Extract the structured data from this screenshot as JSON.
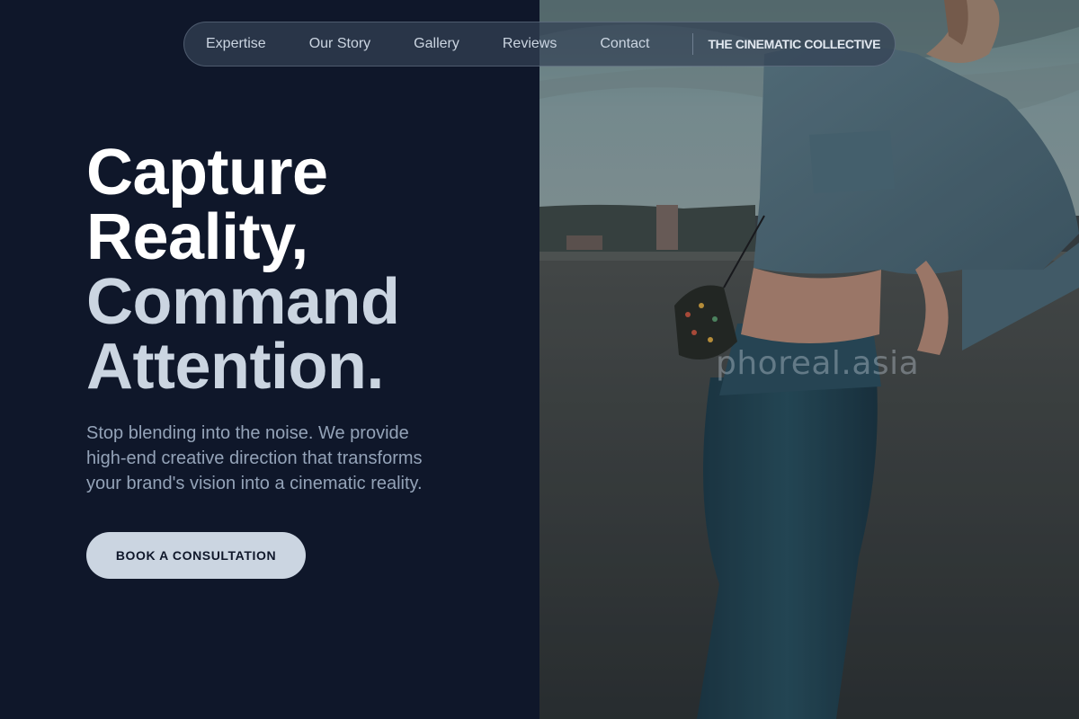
{
  "nav": {
    "links": [
      "Expertise",
      "Our Story",
      "Gallery",
      "Reviews",
      "Contact"
    ],
    "brand": "THE CINEMATIC COLLECTIVE"
  },
  "hero": {
    "title_lines": [
      "Capture",
      "Reality,",
      "Command",
      "Attention."
    ],
    "subtitle": "Stop blending into the noise. We provide high-end creative direction that transforms your brand's vision into a cinematic reality.",
    "cta_label": "BOOK A CONSULTATION"
  },
  "photo": {
    "watermark": "phoreal.asia"
  },
  "colors": {
    "background": "#0f172a",
    "nav_text": "#cbd5e1",
    "title_primary": "#ffffff",
    "title_secondary": "#cbd5e1",
    "subtitle": "#94a3b8",
    "cta_bg": "#cbd5e1",
    "cta_text": "#0f172a"
  }
}
